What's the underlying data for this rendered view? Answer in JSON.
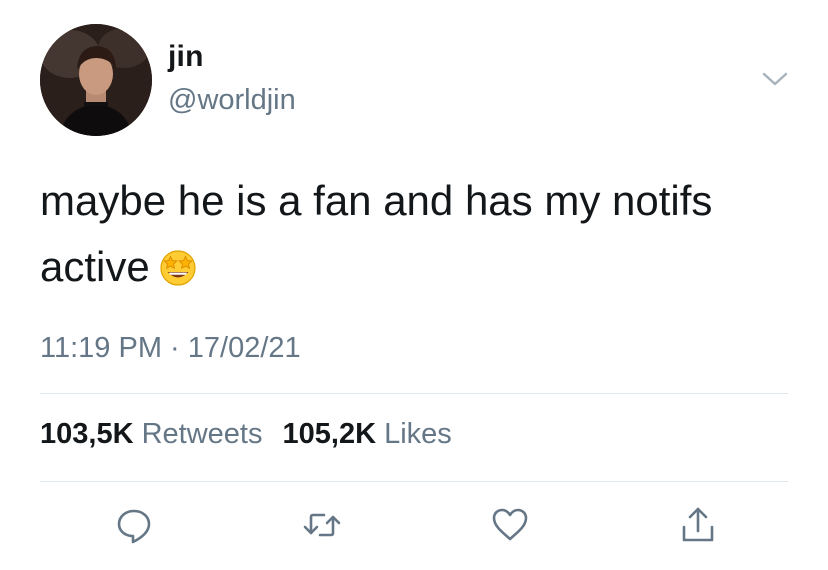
{
  "user": {
    "display_name": "jin",
    "handle": "@worldjin",
    "avatar_icon": "profile-photo"
  },
  "tweet": {
    "text": "maybe he is a fan and has my notifs active",
    "emoji": "star-struck-emoji",
    "time": "11:19 PM",
    "separator": "·",
    "date": "17/02/21"
  },
  "stats": {
    "retweets_count": "103,5K",
    "retweets_label": "Retweets",
    "likes_count": "105,2K",
    "likes_label": "Likes"
  },
  "actions": [
    "reply-icon",
    "retweet-icon",
    "like-icon",
    "share-icon"
  ],
  "colors": {
    "text": "#14171a",
    "secondary": "#657786",
    "divider": "#e1e8ed",
    "icon": "#657786"
  }
}
